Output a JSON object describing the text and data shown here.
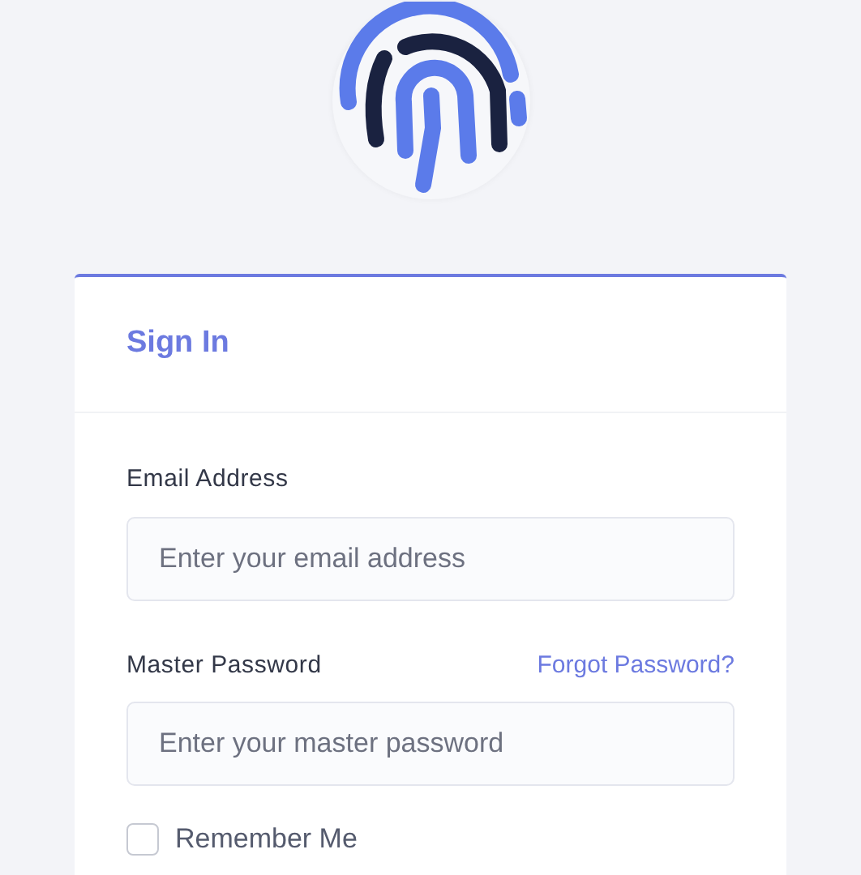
{
  "card": {
    "title": "Sign In"
  },
  "fields": [
    {
      "label": "Email Address",
      "placeholder": "Enter your email address"
    },
    {
      "label": "Master Password",
      "placeholder": "Enter your master password",
      "link": "Forgot Password?"
    }
  ],
  "remember": {
    "label": "Remember Me",
    "checked": false
  }
}
